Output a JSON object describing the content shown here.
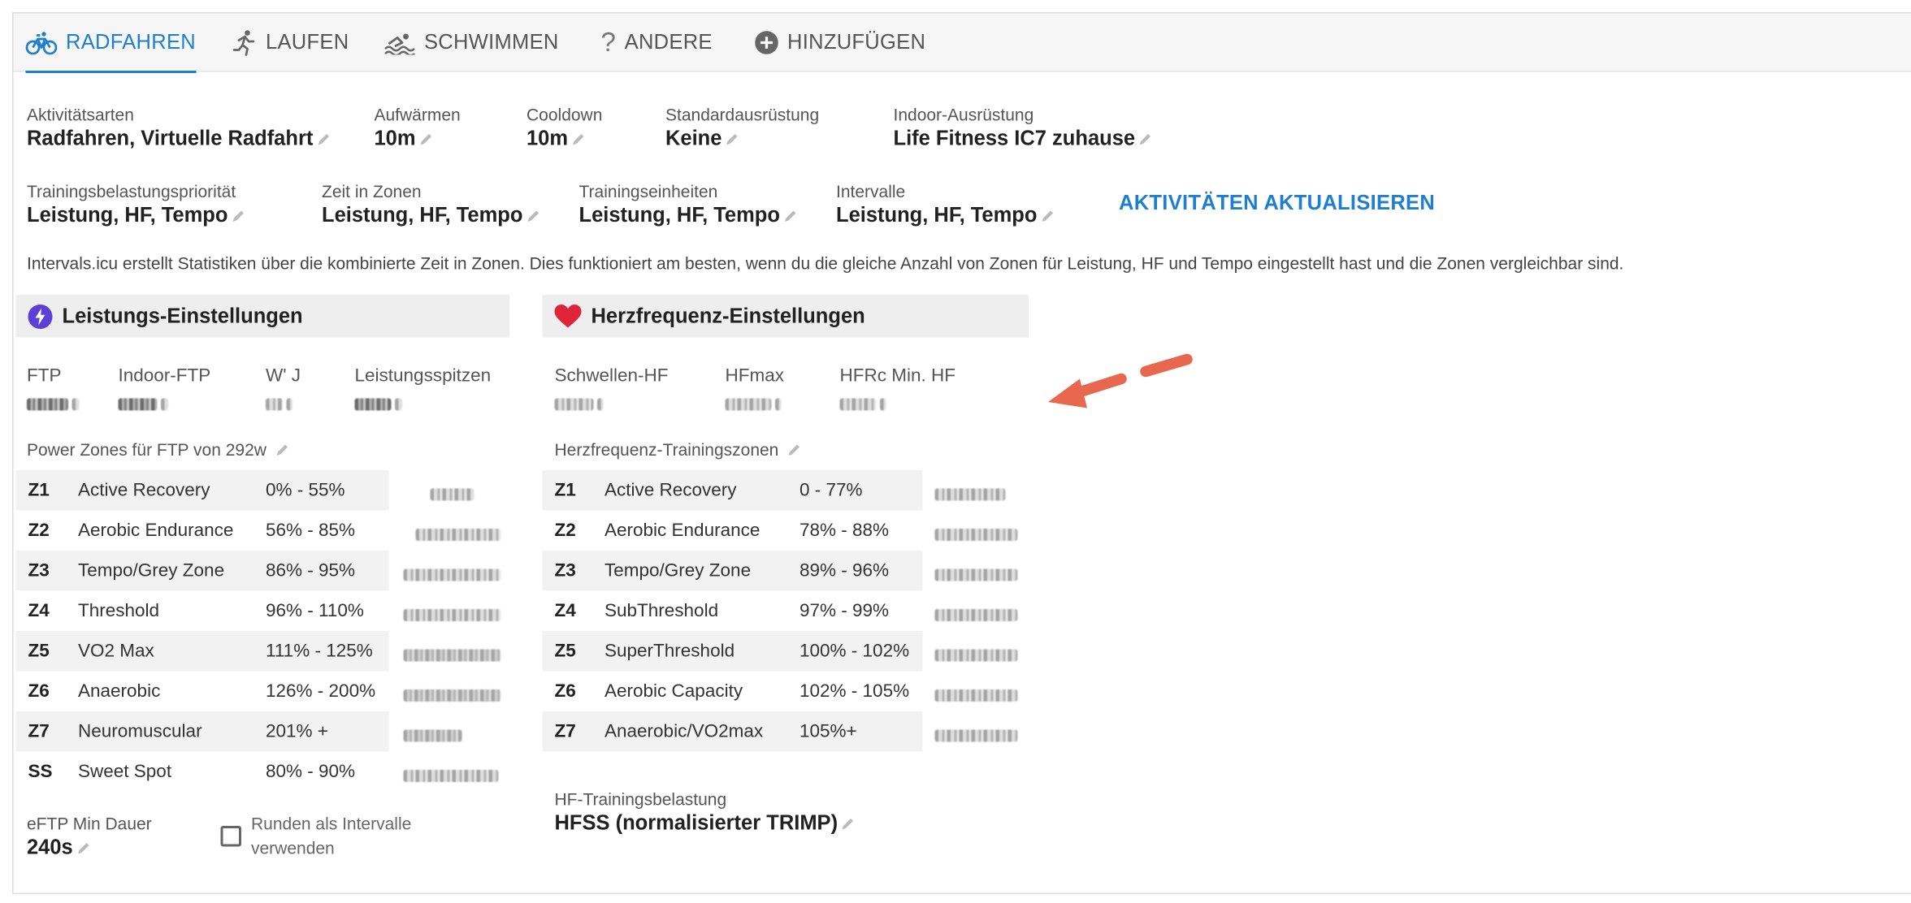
{
  "tabs": [
    {
      "label": "RADFAHREN",
      "icon": "bicycle-icon",
      "active": true
    },
    {
      "label": "LAUFEN",
      "icon": "running-icon",
      "active": false
    },
    {
      "label": "SCHWIMMEN",
      "icon": "swimming-icon",
      "active": false
    },
    {
      "label": "ANDERE",
      "icon": "question-icon",
      "active": false
    },
    {
      "label": "HINZUFÜGEN",
      "icon": "add-circle-icon",
      "active": false
    }
  ],
  "settings": {
    "activity_types": {
      "label": "Aktivitätsarten",
      "value": "Radfahren, Virtuelle Radfahrt"
    },
    "warmup": {
      "label": "Aufwärmen",
      "value": "10m"
    },
    "cooldown": {
      "label": "Cooldown",
      "value": "10m"
    },
    "default_gear": {
      "label": "Standardausrüstung",
      "value": "Keine"
    },
    "indoor_gear": {
      "label": "Indoor-Ausrüstung",
      "value": "Life Fitness IC7 zuhause"
    },
    "load_priority": {
      "label": "Trainingsbelastungspriorität",
      "value": "Leistung, HF, Tempo"
    },
    "time_in_zones": {
      "label": "Zeit in Zonen",
      "value": "Leistung, HF, Tempo"
    },
    "workouts": {
      "label": "Trainingseinheiten",
      "value": "Leistung, HF, Tempo"
    },
    "intervals": {
      "label": "Intervalle",
      "value": "Leistung, HF, Tempo"
    },
    "update_link": "AKTIVITÄTEN AKTUALISIEREN",
    "info": "Intervals.icu erstellt Statistiken über die kombinierte Zeit in Zonen. Dies funktioniert am besten, wenn du die gleiche Anzahl von Zonen für Leistung, HF und Tempo eingestellt hast und die Zonen vergleichbar sind."
  },
  "power": {
    "title": "Leistungs-Einstellungen",
    "stats": [
      {
        "label": "FTP"
      },
      {
        "label": "Indoor-FTP"
      },
      {
        "label": "W' J"
      },
      {
        "label": "Leistungsspitzen"
      }
    ],
    "zones_caption": "Power Zones für FTP von 292w",
    "zones": [
      {
        "id": "Z1",
        "name": "Active Recovery",
        "range": "0% - 55%"
      },
      {
        "id": "Z2",
        "name": "Aerobic Endurance",
        "range": "56% - 85%"
      },
      {
        "id": "Z3",
        "name": "Tempo/Grey Zone",
        "range": "86% - 95%"
      },
      {
        "id": "Z4",
        "name": "Threshold",
        "range": "96% - 110%"
      },
      {
        "id": "Z5",
        "name": "VO2 Max",
        "range": "111% - 125%"
      },
      {
        "id": "Z6",
        "name": "Anaerobic",
        "range": "126% - 200%"
      },
      {
        "id": "Z7",
        "name": "Neuromuscular",
        "range": "201% +"
      },
      {
        "id": "SS",
        "name": "Sweet Spot",
        "range": "80% - 90%"
      }
    ],
    "eftp": {
      "label": "eFTP Min Dauer",
      "value": "240s"
    },
    "laps_checkbox": {
      "label_line1": "Runden als Intervalle",
      "label_line2": "verwenden",
      "checked": false
    }
  },
  "hr": {
    "title": "Herzfrequenz-Einstellungen",
    "stats": [
      {
        "label": "Schwellen-HF"
      },
      {
        "label": "HFmax"
      },
      {
        "label": "HFRc Min. HF"
      }
    ],
    "zones_caption": "Herzfrequenz-Trainingszonen",
    "zones": [
      {
        "id": "Z1",
        "name": "Active Recovery",
        "range": "0 - 77%"
      },
      {
        "id": "Z2",
        "name": "Aerobic Endurance",
        "range": "78% - 88%"
      },
      {
        "id": "Z3",
        "name": "Tempo/Grey Zone",
        "range": "89% - 96%"
      },
      {
        "id": "Z4",
        "name": "SubThreshold",
        "range": "97% - 99%"
      },
      {
        "id": "Z5",
        "name": "SuperThreshold",
        "range": "100% - 102%"
      },
      {
        "id": "Z6",
        "name": "Aerobic Capacity",
        "range": "102% - 105%"
      },
      {
        "id": "Z7",
        "name": "Anaerobic/VO2max",
        "range": "105%+"
      }
    ],
    "load": {
      "label": "HF-Trainingsbelastung",
      "value": "HFSS (normalisierter TRIMP)"
    }
  },
  "colors": {
    "accent": "#1e7fd0",
    "power_icon": "#5b3fd6",
    "heart_icon": "#e0243a",
    "arrow": "#e8674f"
  }
}
